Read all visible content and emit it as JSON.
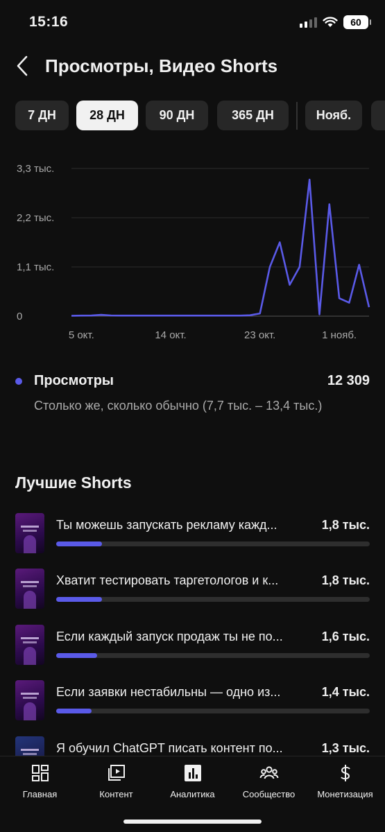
{
  "status": {
    "time": "15:16",
    "battery": "60"
  },
  "header": {
    "title": "Просмотры, Видео Shorts"
  },
  "chips": [
    {
      "label": "7 ДН",
      "active": false
    },
    {
      "label": "28 ДН",
      "active": true
    },
    {
      "label": "90 ДН",
      "active": false
    },
    {
      "label": "365 ДН",
      "active": false
    },
    {
      "label": "Нояб.",
      "active": false
    }
  ],
  "chart_data": {
    "type": "line",
    "ytick_labels": [
      "3,3 тыс.",
      "2,2 тыс.",
      "1,1 тыс.",
      "0"
    ],
    "yticks": [
      3300,
      2200,
      1100,
      0
    ],
    "ylim": [
      0,
      3300
    ],
    "xtick_labels": [
      "5 окт.",
      "14 окт.",
      "23 окт.",
      "1 нояб."
    ],
    "xtick_index": [
      1,
      10,
      19,
      27
    ],
    "grid": true,
    "color": "#5a5ae8",
    "series": [
      {
        "values": [
          10,
          12,
          14,
          30,
          15,
          12,
          12,
          12,
          12,
          12,
          12,
          12,
          12,
          12,
          12,
          12,
          12,
          12,
          20,
          60,
          1100,
          1650,
          700,
          1100,
          3050,
          40,
          2500,
          400,
          300,
          1150,
          200
        ]
      }
    ]
  },
  "metric": {
    "name": "Просмотры",
    "value": "12 309",
    "note": "Столько же, сколько обычно (7,7 тыс. – 13,4 тыс.)"
  },
  "top_shorts": {
    "title": "Лучшие Shorts",
    "items": [
      {
        "label": "Ты можешь запускать рекламу кажд...",
        "count": "1,8 тыс.",
        "views": 1800
      },
      {
        "label": "Хватит тестировать таргетологов и к...",
        "count": "1,8 тыс.",
        "views": 1800
      },
      {
        "label": "Если каждый запуск продаж ты не по...",
        "count": "1,6 тыс.",
        "views": 1600
      },
      {
        "label": "Если заявки нестабильны — одно из...",
        "count": "1,4 тыс.",
        "views": 1400
      },
      {
        "label": "Я обучил ChatGPT писать контент по...",
        "count": "1,3 тыс.",
        "views": 1300
      }
    ],
    "bar_max_views": 12309
  },
  "bottom_nav": [
    {
      "label": "Главная",
      "icon": "dashboard-icon"
    },
    {
      "label": "Контент",
      "icon": "content-icon"
    },
    {
      "label": "Аналитика",
      "icon": "analytics-icon"
    },
    {
      "label": "Сообщество",
      "icon": "community-icon"
    },
    {
      "label": "Монетизация",
      "icon": "dollar-icon"
    }
  ]
}
